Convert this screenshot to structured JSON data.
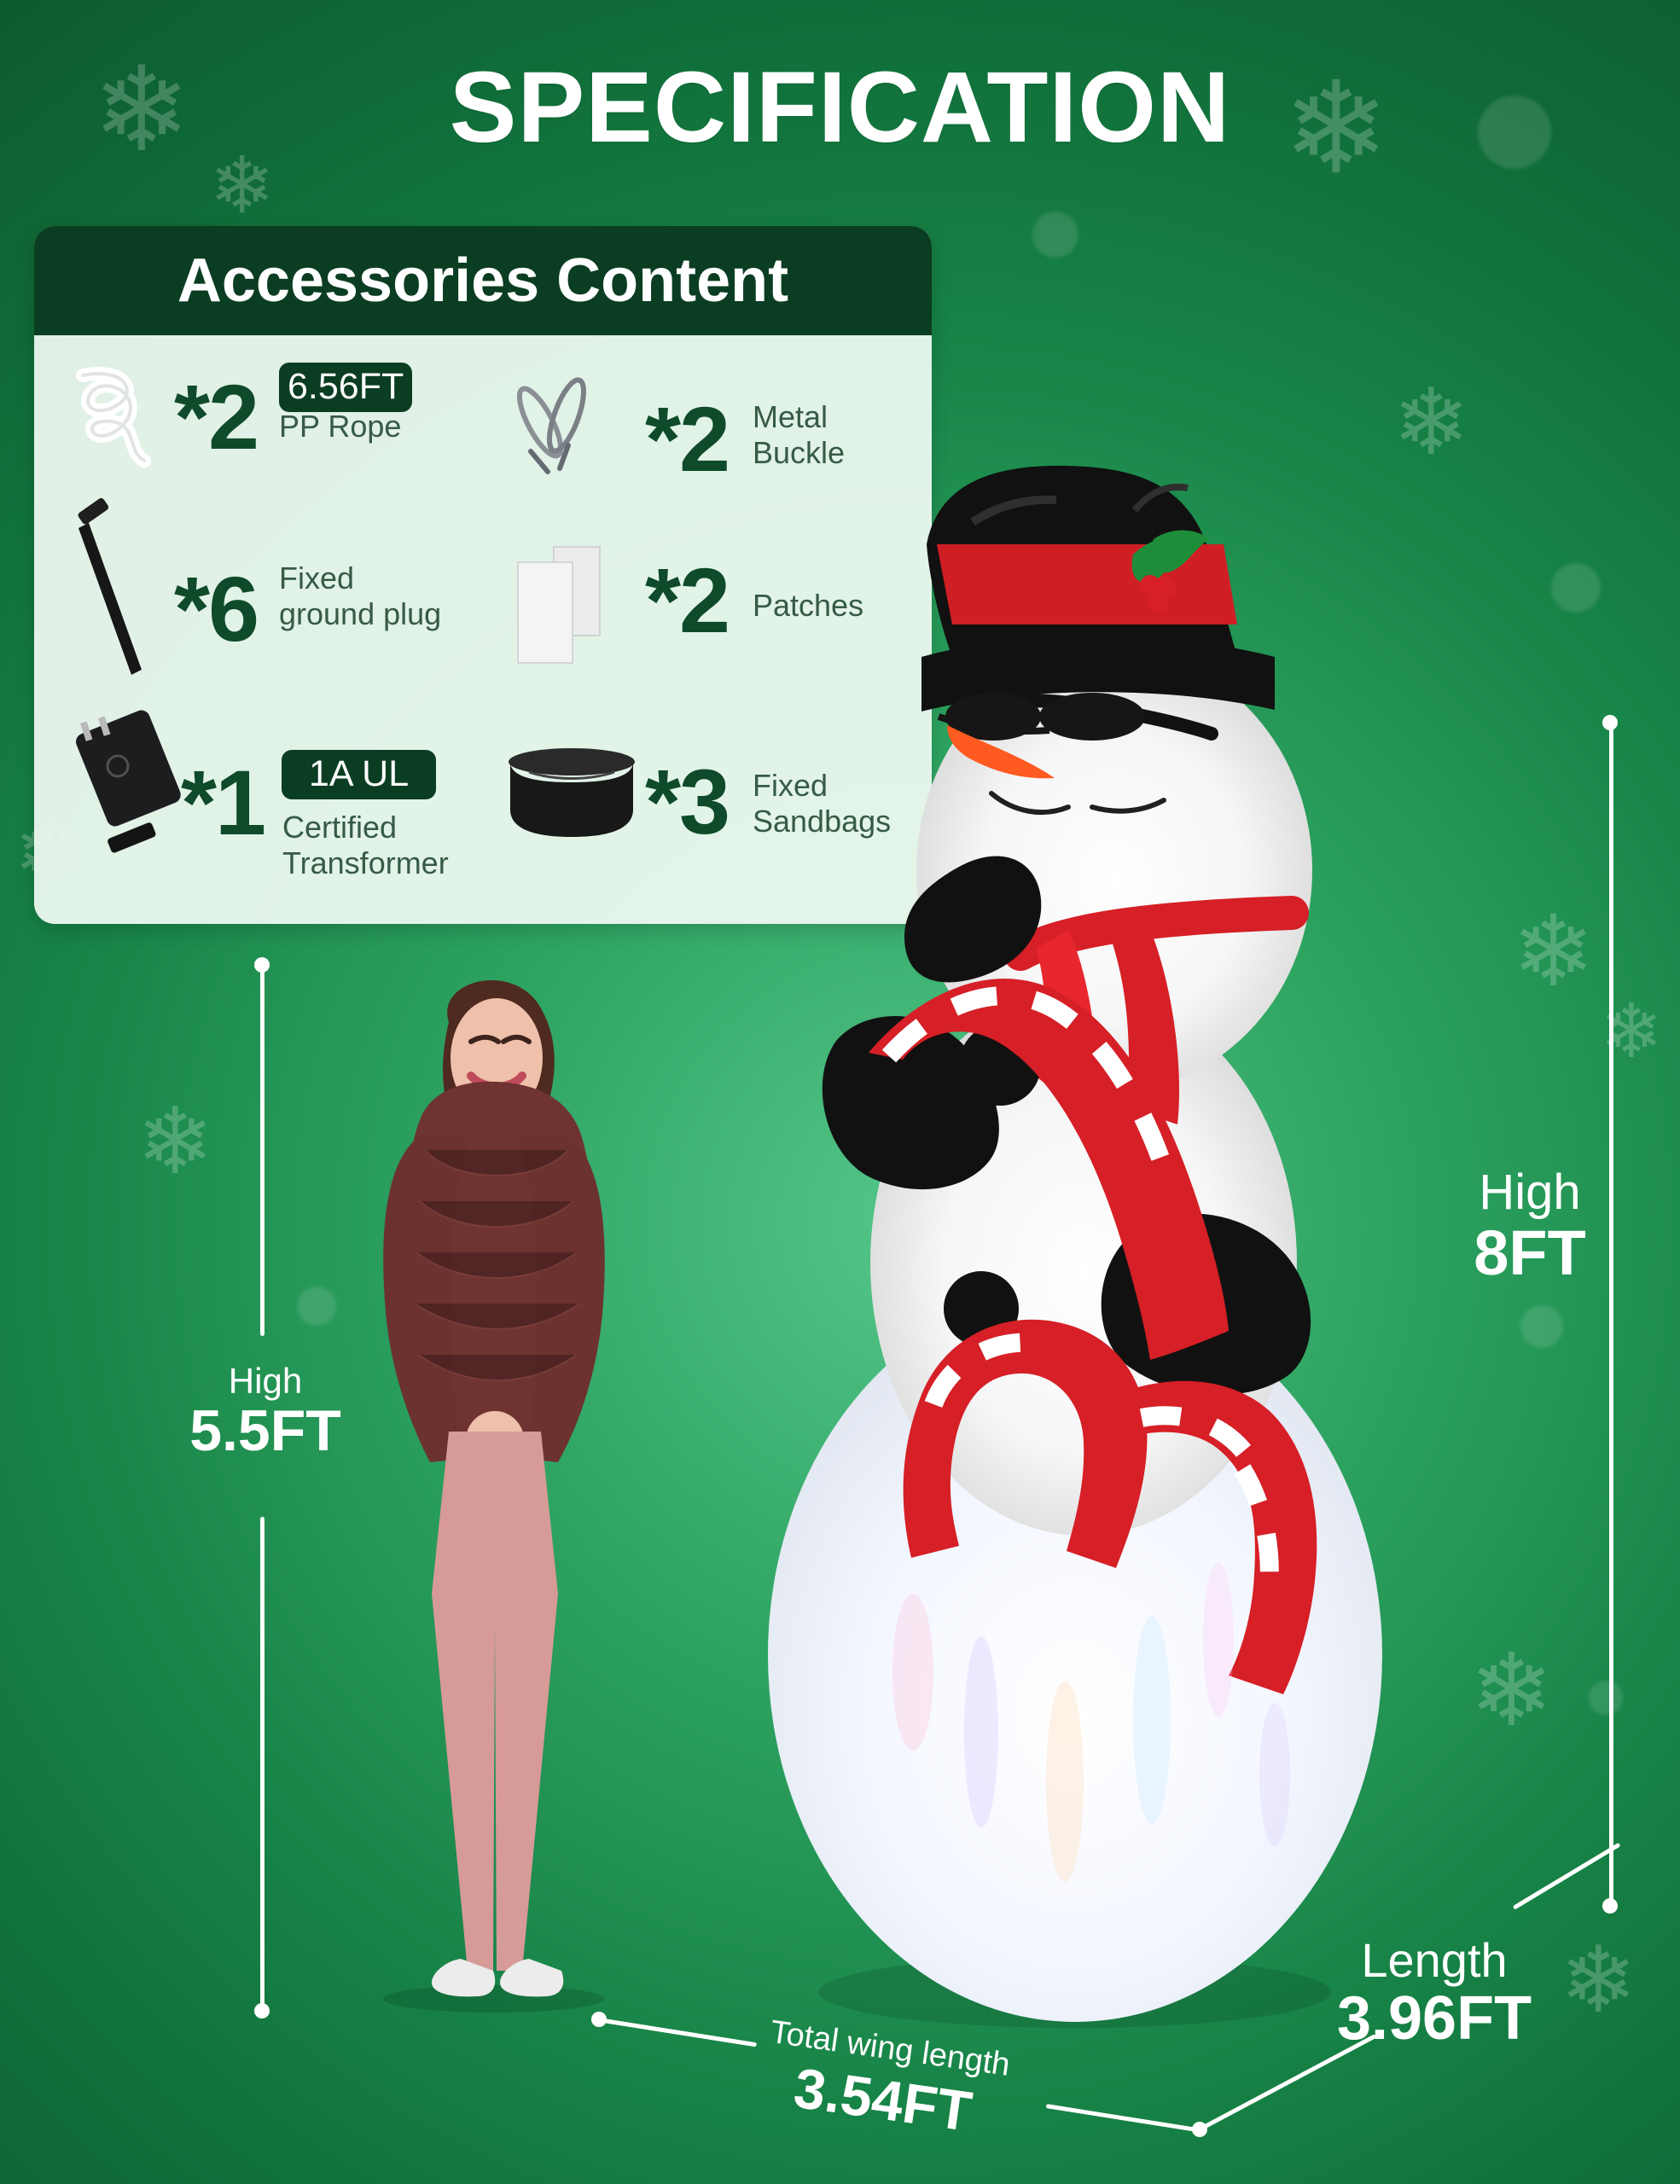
{
  "title": "SPECIFICATION",
  "card": {
    "title": "Accessories Content",
    "items": [
      {
        "count": "*2",
        "badge": "6.56FT",
        "label_lines": [
          "PP Rope"
        ],
        "icon": "rope-icon"
      },
      {
        "count": "*2",
        "label_lines": [
          "Metal",
          "Buckle"
        ],
        "icon": "metal-buckle-icon"
      },
      {
        "count": "*6",
        "label_lines": [
          "Fixed",
          "ground plug"
        ],
        "icon": "ground-stake-icon"
      },
      {
        "count": "*2",
        "label_lines": [
          "Patches"
        ],
        "icon": "patch-icon"
      },
      {
        "count": "*1",
        "badge": "1A UL",
        "label_lines": [
          "Certified",
          "Transformer"
        ],
        "icon": "power-adapter-icon"
      },
      {
        "count": "*3",
        "label_lines": [
          "Fixed",
          "Sandbags"
        ],
        "icon": "sandbag-icon"
      }
    ]
  },
  "measurements": {
    "person": {
      "label": "High",
      "value": "5.5FT"
    },
    "snowman_height": {
      "label": "High",
      "value": "8FT"
    },
    "length": {
      "label": "Length",
      "value": "3.96FT"
    },
    "wing": {
      "label": "Total wing length",
      "value": "3.54FT"
    }
  },
  "colors": {
    "background_dark": "#0d5b30",
    "background_mid": "#178346",
    "background_light": "#55c68a",
    "card_header": "#0b3d22",
    "card_body": "#eef9f1",
    "accent_red": "#d61f26",
    "accent_green": "#0f4b2a"
  },
  "icons": [
    "snowflake-icon",
    "rope-icon",
    "metal-buckle-icon",
    "ground-stake-icon",
    "patch-icon",
    "power-adapter-icon",
    "sandbag-icon"
  ]
}
